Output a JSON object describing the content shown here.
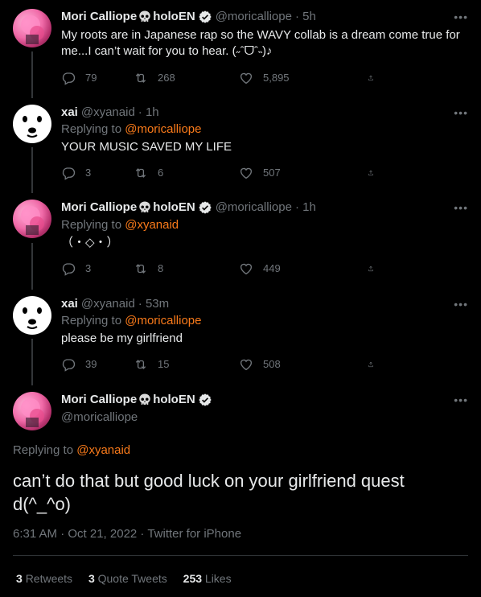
{
  "tweets": [
    {
      "name": "Mori Calliope",
      "name_suffix": "holoEN",
      "handle": "@moricalliope",
      "time": "· 5h",
      "text_line1": "My roots are in Japanese rap so the WAVY collab is a dream come true for",
      "text_line2": "me...I can’t wait for you to hear. (˶ˆᗜˆ˵)♪",
      "replies": "79",
      "retweets": "268",
      "likes": "5,895"
    },
    {
      "name": "xai",
      "handle": "@xyanaid",
      "time": "· 1h",
      "replying_prefix": "Replying to",
      "replying_to": "@moricalliope",
      "text": "YOUR MUSIC SAVED MY LIFE",
      "replies": "3",
      "retweets": "6",
      "likes": "507"
    },
    {
      "name": "Mori Calliope",
      "name_suffix": "holoEN",
      "handle": "@moricalliope",
      "time": "· 1h",
      "replying_prefix": "Replying to",
      "replying_to": "@xyanaid",
      "text": "（・◇・）",
      "replies": "3",
      "retweets": "8",
      "likes": "449"
    },
    {
      "name": "xai",
      "handle": "@xyanaid",
      "time": "· 53m",
      "replying_prefix": "Replying to",
      "replying_to": "@moricalliope",
      "text": "please be my girlfriend",
      "replies": "39",
      "retweets": "15",
      "likes": "508"
    }
  ],
  "focus": {
    "name": "Mori Calliope",
    "name_suffix": "holoEN",
    "handle": "@moricalliope",
    "replying_prefix": "Replying to",
    "replying_to": "@xyanaid",
    "text_line1": "can’t do that but good luck on your girlfriend quest",
    "text_line2": "d(^_^o)",
    "timestamp": "6:31 AM · Oct 21, 2022 · Twitter for iPhone",
    "retweets": "3",
    "retweets_label": "Retweets",
    "quote_tweets": "3",
    "quote_tweets_label": "Quote Tweets",
    "likes": "253",
    "likes_label": "Likes"
  },
  "icons": {
    "more": "more-icon",
    "reply": "reply-icon",
    "retweet": "retweet-icon",
    "like": "like-icon",
    "share": "share-icon",
    "verified": "verified-badge-icon",
    "skull": "skull-icon"
  },
  "colors": {
    "background": "#000000",
    "text": "#e7e9ea",
    "muted": "#71767b",
    "mention": "#f97a1a",
    "divider": "#2f3336"
  }
}
